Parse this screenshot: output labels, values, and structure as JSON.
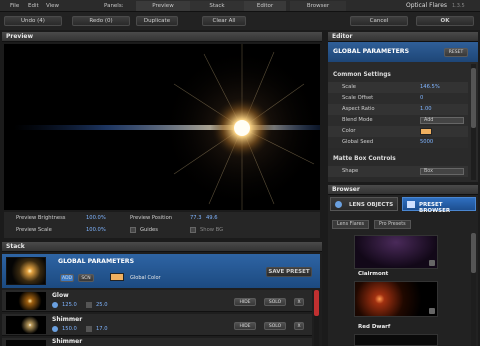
{
  "menubar": {
    "items": [
      "File",
      "Edit",
      "View"
    ],
    "panels_label": "Panels:",
    "panel_tabs": [
      "Preview",
      "Stack",
      "Editor",
      "Browser"
    ],
    "app_title": "Optical Flares",
    "version": "1.3.5"
  },
  "toolbar": {
    "undo": "Undo (4)",
    "redo": "Redo (0)",
    "duplicate": "Duplicate",
    "clear_all": "Clear All",
    "cancel": "Cancel",
    "ok": "OK"
  },
  "preview": {
    "title": "Preview",
    "brightness_label": "Preview Brightness",
    "brightness_value": "100.0%",
    "scale_label": "Preview Scale",
    "scale_value": "100.0%",
    "position_label": "Preview Position",
    "position_x": "77.3",
    "position_y": "49.6",
    "guides_label": "Guides",
    "show_bg_label": "Show BG"
  },
  "editor": {
    "title": "Editor",
    "section": "GLOBAL PARAMETERS",
    "reset": "RESET",
    "common_title": "Common Settings",
    "rows": [
      {
        "label": "Scale",
        "value": "146.5%"
      },
      {
        "label": "Scale Offset",
        "value": "0"
      },
      {
        "label": "Aspect Ratio",
        "value": "1.00"
      },
      {
        "label": "Blend Mode",
        "value": "Add"
      },
      {
        "label": "Color",
        "value": ""
      },
      {
        "label": "Global Seed",
        "value": "5000"
      }
    ],
    "color_swatch": "#f0b060",
    "matte_title": "Matte Box Controls",
    "shape_label": "Shape",
    "shape_value": "Box"
  },
  "browser": {
    "title": "Browser",
    "lens_objects": "LENS OBJECTS",
    "preset_browser": "PRESET BROWSER",
    "crumbs": [
      "Lens Flares",
      "Pro Presets"
    ],
    "items": [
      {
        "name": "Clairmont"
      },
      {
        "name": "Red Dwarf"
      }
    ]
  },
  "stack": {
    "title": "Stack",
    "global": {
      "title": "GLOBAL PARAMETERS",
      "add": "ADD",
      "scn": "SCN",
      "color_label": "Global Color",
      "save_preset": "SAVE PRESET",
      "swatch": "#f0b060"
    },
    "layers": [
      {
        "name": "Glow",
        "v1": "125.0",
        "v2": "25.0",
        "hide": "HIDE",
        "solo": "SOLO",
        "x": "X"
      },
      {
        "name": "Shimmer",
        "v1": "150.0",
        "v2": "17.0",
        "hide": "HIDE",
        "solo": "SOLO",
        "x": "X"
      },
      {
        "name": "Shimmer"
      }
    ]
  },
  "colors": {
    "accent_blue": "#1d5fa8",
    "value_blue": "#7fb4ff"
  }
}
